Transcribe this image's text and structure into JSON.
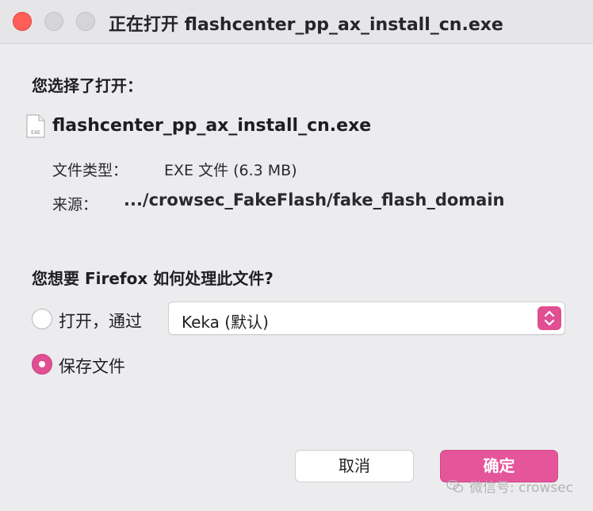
{
  "window": {
    "title": "正在打开 flashcenter_pp_ax_install_cn.exe"
  },
  "dialog": {
    "open_heading": "您选择了打开：",
    "file": {
      "name": "flashcenter_pp_ax_install_cn.exe",
      "icon_label": "EXE",
      "type_label": "文件类型：",
      "type_value": "EXE 文件 (6.3 MB)",
      "source_label": "来源：",
      "source_value": ".../crowsec_FakeFlash/fake_flash_domain"
    },
    "question": "您想要 Firefox 如何处理此文件?",
    "options": {
      "open_with_label": "打开，通过",
      "open_with_app": "Keka (默认)",
      "save_label": "保存文件",
      "selected": "save"
    },
    "buttons": {
      "cancel": "取消",
      "ok": "确定"
    },
    "watermark": "微信号: crowsec"
  },
  "colors": {
    "accent": "#e5559a",
    "close": "#ff5f57"
  }
}
